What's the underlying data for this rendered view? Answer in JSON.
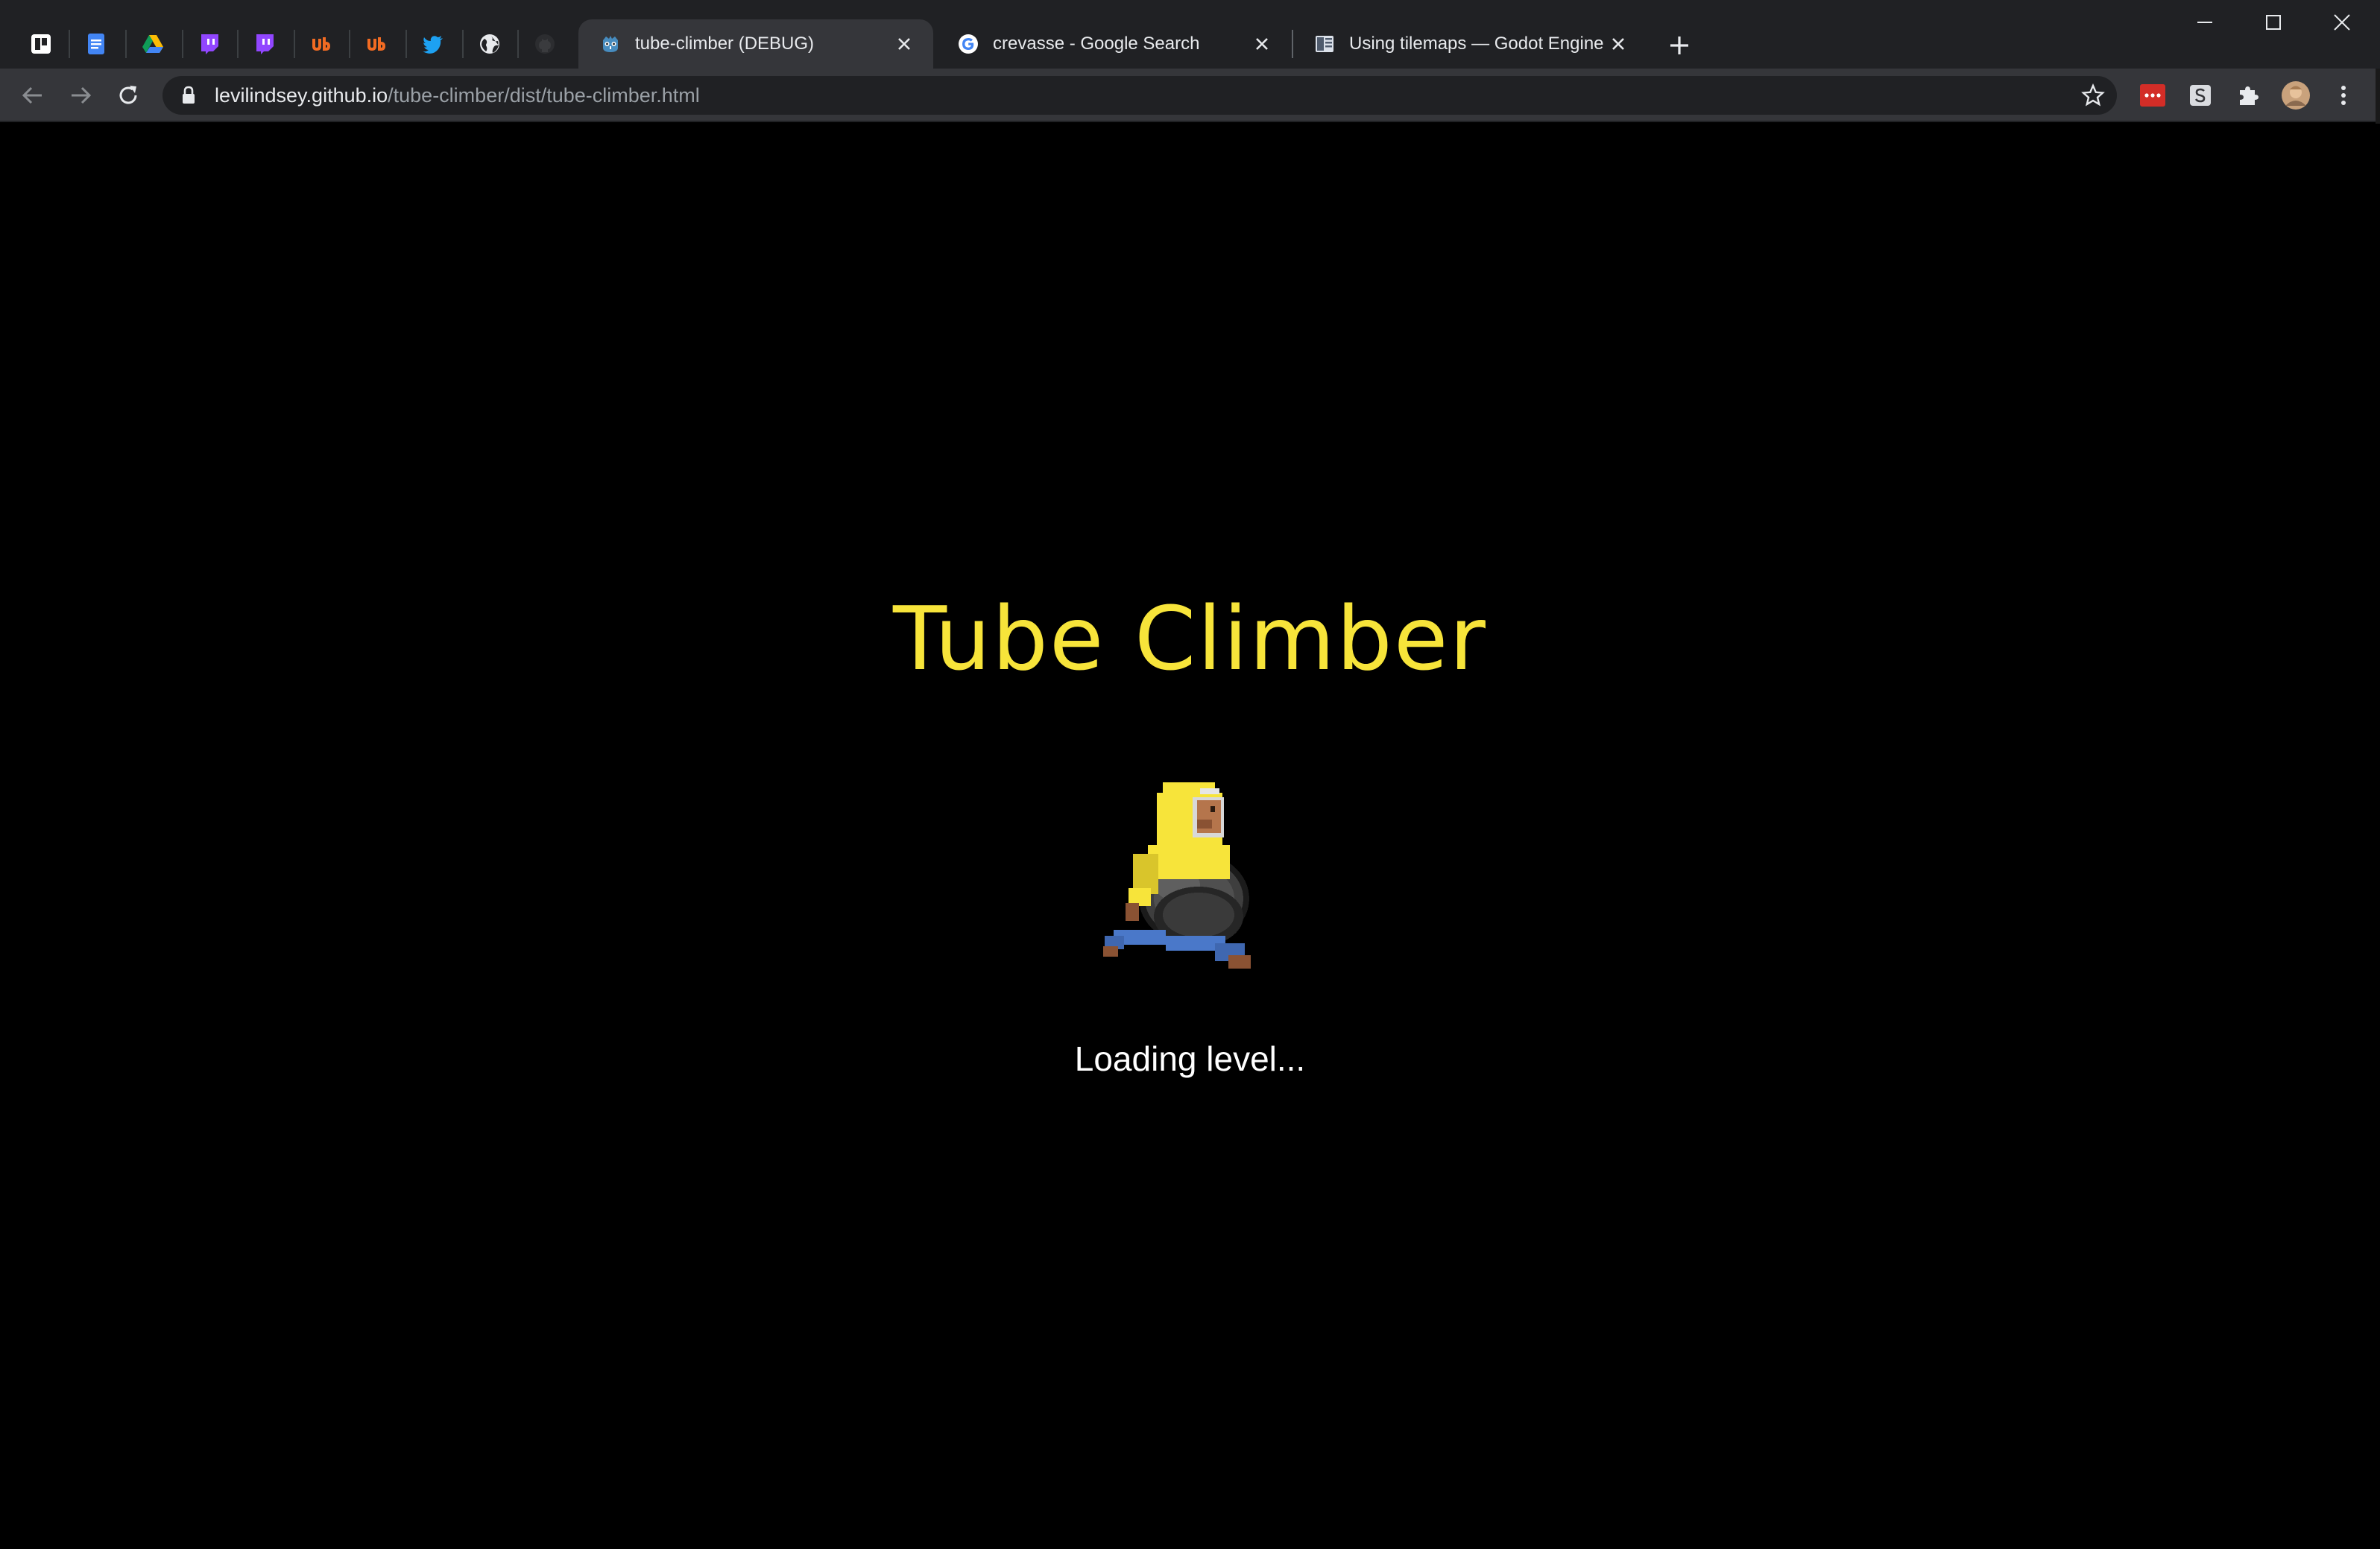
{
  "browser": {
    "pinned_tabs": [
      {
        "icon": "trello-icon"
      },
      {
        "icon": "google-docs-icon"
      },
      {
        "icon": "google-drive-icon"
      },
      {
        "icon": "twitch-icon"
      },
      {
        "icon": "twitch-icon"
      },
      {
        "icon": "ublock-icon"
      },
      {
        "icon": "ublock-icon"
      },
      {
        "icon": "twitter-icon"
      },
      {
        "icon": "globe-icon"
      },
      {
        "icon": "github-icon"
      }
    ],
    "tabs": [
      {
        "title": "tube-climber (DEBUG)",
        "icon": "godot-icon",
        "active": true
      },
      {
        "title": "crevasse - Google Search",
        "icon": "google-icon",
        "active": false
      },
      {
        "title": "Using tilemaps — Godot Engine (",
        "icon": "godot-docs-icon",
        "active": false
      }
    ],
    "address": {
      "domain": "levilindsey.github.io",
      "path": "/tube-climber/dist/tube-climber.html"
    }
  },
  "page": {
    "title": "Tube Climber",
    "status": "Loading level...",
    "title_color": "#f7e43a"
  }
}
